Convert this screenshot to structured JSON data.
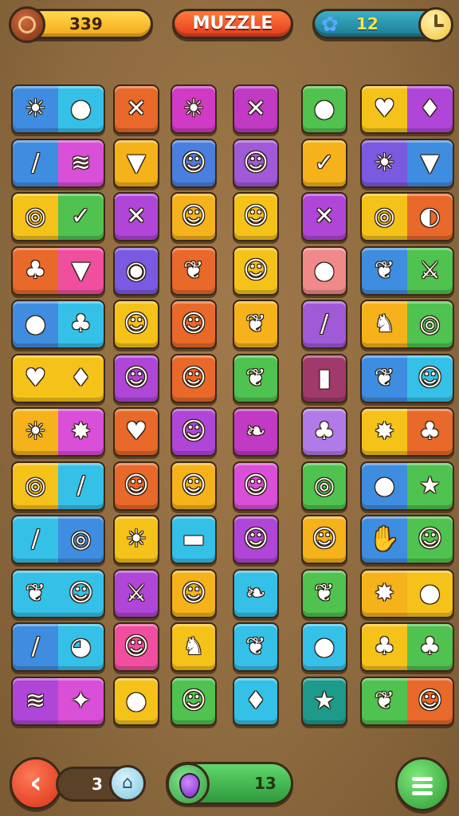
{
  "header": {
    "coins": "339",
    "title": "MUZZLE",
    "gems": "12",
    "icons": [
      "coin-icon",
      "gem-icon",
      "clock-icon"
    ]
  },
  "footer": {
    "back_label": "‹",
    "moves": "3",
    "energy": "13",
    "icons": [
      "back-arrow-icon",
      "lock-icon",
      "energy-drop-icon",
      "menu-icon"
    ]
  },
  "board": {
    "rows": [
      [
        {
          "cols": [
            0,
            1
          ],
          "bg": [
            "#3f8de0",
            "#35c0e8"
          ],
          "icons": [
            "☀",
            "●"
          ],
          "names": [
            "gear-icon",
            "lemon-icon"
          ]
        },
        {
          "cols": [
            2
          ],
          "bg": [
            "#e8692a"
          ],
          "icons": [
            "✕"
          ],
          "names": [
            "crossed-tools-icon"
          ]
        },
        {
          "cols": [
            3
          ],
          "bg": [
            "#d03ac4"
          ],
          "icons": [
            "☀"
          ],
          "names": [
            "sun-icon"
          ]
        },
        {
          "cols": [
            4
          ],
          "bg": [
            "#c03ac4"
          ],
          "icons": [
            "✕"
          ],
          "names": [
            "crossed-tools-icon"
          ]
        },
        {
          "cols": [
            5
          ],
          "bg": [
            "#4fc24f"
          ],
          "icons": [
            "●"
          ],
          "names": [
            "jar-icon"
          ]
        },
        {
          "cols": [
            6,
            7
          ],
          "bg": [
            "#f5c21a",
            "#b046d8"
          ],
          "icons": [
            "♥",
            "♦"
          ],
          "names": [
            "heart-icon",
            "eggplant-icon"
          ]
        }
      ],
      [
        {
          "cols": [
            0,
            1
          ],
          "bg": [
            "#3f8de0",
            "#d94fd8"
          ],
          "icons": [
            "/",
            "≋"
          ],
          "names": [
            "brush-icon",
            "bacon-icon"
          ]
        },
        {
          "cols": [
            2
          ],
          "bg": [
            "#f5b21a"
          ],
          "icons": [
            "▼"
          ],
          "names": [
            "ice-cream-icon"
          ]
        },
        {
          "cols": [
            3
          ],
          "bg": [
            "#4a7fe0"
          ],
          "icons": [
            "☺"
          ],
          "names": [
            "cat-face-icon"
          ]
        },
        {
          "cols": [
            4
          ],
          "bg": [
            "#a05ad8"
          ],
          "icons": [
            "☺"
          ],
          "names": [
            "boy-face-icon"
          ]
        },
        {
          "cols": [
            5
          ],
          "bg": [
            "#f5b21a"
          ],
          "icons": [
            "✓"
          ],
          "names": [
            "check-icon"
          ]
        },
        {
          "cols": [
            6,
            7
          ],
          "bg": [
            "#7a5ae0",
            "#3f8de0"
          ],
          "icons": [
            "☀",
            "▼"
          ],
          "names": [
            "sun-icon",
            "ice-cream-icon"
          ]
        }
      ],
      [
        {
          "cols": [
            0,
            1
          ],
          "bg": [
            "#f5c21a",
            "#4fc24f"
          ],
          "icons": [
            "◎",
            "✓"
          ],
          "names": [
            "swirl-icon",
            "leaf-icon"
          ]
        },
        {
          "cols": [
            2
          ],
          "bg": [
            "#b046d8"
          ],
          "icons": [
            "✕"
          ],
          "names": [
            "crossed-tools-icon"
          ]
        },
        {
          "cols": [
            3
          ],
          "bg": [
            "#f5b21a"
          ],
          "icons": [
            "☺"
          ],
          "names": [
            "mouse-face-icon"
          ]
        },
        {
          "cols": [
            4
          ],
          "bg": [
            "#f5c21a"
          ],
          "icons": [
            "☺"
          ],
          "names": [
            "bear-face-icon"
          ]
        },
        {
          "cols": [
            5
          ],
          "bg": [
            "#b046d8"
          ],
          "icons": [
            "✕"
          ],
          "names": [
            "crossed-tools-icon"
          ]
        },
        {
          "cols": [
            6,
            7
          ],
          "bg": [
            "#f5c21a",
            "#e8692a"
          ],
          "icons": [
            "◎",
            "◐"
          ],
          "names": [
            "swirl-icon",
            "pepper-icon"
          ]
        }
      ],
      [
        {
          "cols": [
            0,
            1
          ],
          "bg": [
            "#e8692a",
            "#f04fa0"
          ],
          "icons": [
            "♣",
            "▼"
          ],
          "names": [
            "pepper-icon",
            "ice-cream-icon"
          ]
        },
        {
          "cols": [
            2
          ],
          "bg": [
            "#7a5ae0"
          ],
          "icons": [
            "◉"
          ],
          "names": [
            "donut-icon"
          ]
        },
        {
          "cols": [
            3
          ],
          "bg": [
            "#e8692a"
          ],
          "icons": [
            "❦"
          ],
          "names": [
            "leaf-icon"
          ]
        },
        {
          "cols": [
            4
          ],
          "bg": [
            "#f5c21a"
          ],
          "icons": [
            "☺"
          ],
          "names": [
            "robot-face-icon"
          ]
        },
        {
          "cols": [
            5
          ],
          "bg": [
            "#f08a8a"
          ],
          "icons": [
            "●"
          ],
          "names": [
            "apple-icon"
          ]
        },
        {
          "cols": [
            6,
            7
          ],
          "bg": [
            "#3f8de0",
            "#4fc24f"
          ],
          "icons": [
            "❦",
            "⚔"
          ],
          "names": [
            "leaf-icon",
            "sword-icon"
          ]
        }
      ],
      [
        {
          "cols": [
            0,
            1
          ],
          "bg": [
            "#3f8de0",
            "#35c0e8"
          ],
          "icons": [
            "●",
            "♣"
          ],
          "names": [
            "apple-icon",
            "tree-icon"
          ]
        },
        {
          "cols": [
            2
          ],
          "bg": [
            "#f5c21a"
          ],
          "icons": [
            "☺"
          ],
          "names": [
            "blob-face-icon"
          ]
        },
        {
          "cols": [
            3
          ],
          "bg": [
            "#e8692a"
          ],
          "icons": [
            "☺"
          ],
          "names": [
            "boy-face-icon"
          ]
        },
        {
          "cols": [
            4
          ],
          "bg": [
            "#f5b21a"
          ],
          "icons": [
            "❦"
          ],
          "names": [
            "leaf-icon"
          ]
        },
        {
          "cols": [
            5
          ],
          "bg": [
            "#a05ad8"
          ],
          "icons": [
            "/"
          ],
          "names": [
            "carrot-icon"
          ]
        },
        {
          "cols": [
            6,
            7
          ],
          "bg": [
            "#f5b21a",
            "#4fc24f"
          ],
          "icons": [
            "♞",
            "◎"
          ],
          "names": [
            "wood-icon",
            "lime-icon"
          ]
        }
      ],
      [
        {
          "cols": [
            0,
            1
          ],
          "bg": [
            "#f5c21a",
            "#f5c21a"
          ],
          "icons": [
            "♥",
            "♦"
          ],
          "names": [
            "heart-icon",
            "peach-icon"
          ]
        },
        {
          "cols": [
            2
          ],
          "bg": [
            "#b046d8"
          ],
          "icons": [
            "☺"
          ],
          "names": [
            "monkey-face-icon"
          ]
        },
        {
          "cols": [
            3
          ],
          "bg": [
            "#e8692a"
          ],
          "icons": [
            "☺"
          ],
          "names": [
            "cat-face-icon"
          ]
        },
        {
          "cols": [
            4
          ],
          "bg": [
            "#4fc24f"
          ],
          "icons": [
            "❦"
          ],
          "names": [
            "leaf-icon"
          ]
        },
        {
          "cols": [
            5
          ],
          "bg": [
            "#a03a6a"
          ],
          "icons": [
            "▮"
          ],
          "names": [
            "bottle-icon"
          ]
        },
        {
          "cols": [
            6,
            7
          ],
          "bg": [
            "#3f8de0",
            "#35c0e8"
          ],
          "icons": [
            "❦",
            "☺"
          ],
          "names": [
            "leaf-icon",
            "smiley-icon"
          ]
        }
      ],
      [
        {
          "cols": [
            0,
            1
          ],
          "bg": [
            "#f5b21a",
            "#d94fd8"
          ],
          "icons": [
            "☀",
            "✸"
          ],
          "names": [
            "sun-icon",
            "star-burst-icon"
          ]
        },
        {
          "cols": [
            2
          ],
          "bg": [
            "#e8692a"
          ],
          "icons": [
            "♥"
          ],
          "names": [
            "heart-face-icon"
          ]
        },
        {
          "cols": [
            3
          ],
          "bg": [
            "#b046d8"
          ],
          "icons": [
            "☺"
          ],
          "names": [
            "lion-face-icon"
          ]
        },
        {
          "cols": [
            4
          ],
          "bg": [
            "#c03ac4"
          ],
          "icons": [
            "❧"
          ],
          "names": [
            "vine-icon"
          ]
        },
        {
          "cols": [
            5
          ],
          "bg": [
            "#b07ae8"
          ],
          "icons": [
            "♣"
          ],
          "names": [
            "tree-icon"
          ]
        },
        {
          "cols": [
            6,
            7
          ],
          "bg": [
            "#f5c21a",
            "#e8692a"
          ],
          "icons": [
            "✸",
            "♣"
          ],
          "names": [
            "splash-icon",
            "tree-icon"
          ]
        }
      ],
      [
        {
          "cols": [
            0,
            1
          ],
          "bg": [
            "#f5c21a",
            "#35c0e8"
          ],
          "icons": [
            "◎",
            "/"
          ],
          "names": [
            "swirl-icon",
            "carrot-icon"
          ]
        },
        {
          "cols": [
            2
          ],
          "bg": [
            "#e8692a"
          ],
          "icons": [
            "☺"
          ],
          "names": [
            "robot-face-icon"
          ]
        },
        {
          "cols": [
            3
          ],
          "bg": [
            "#f5b21a"
          ],
          "icons": [
            "☺"
          ],
          "names": [
            "cat-face-icon"
          ]
        },
        {
          "cols": [
            4
          ],
          "bg": [
            "#d94fd8"
          ],
          "icons": [
            "☺"
          ],
          "names": [
            "sheep-face-icon"
          ]
        },
        {
          "cols": [
            5
          ],
          "bg": [
            "#4fc24f"
          ],
          "icons": [
            "◎"
          ],
          "names": [
            "swirl-icon"
          ]
        },
        {
          "cols": [
            6,
            7
          ],
          "bg": [
            "#3f8de0",
            "#4fc24f"
          ],
          "icons": [
            "●",
            "★"
          ],
          "names": [
            "apple-icon",
            "star-icon"
          ]
        }
      ],
      [
        {
          "cols": [
            0,
            1
          ],
          "bg": [
            "#35c0e8",
            "#3f8de0"
          ],
          "icons": [
            "/",
            "◎"
          ],
          "names": [
            "carrot-icon",
            "ball-icon"
          ]
        },
        {
          "cols": [
            2
          ],
          "bg": [
            "#f5c21a"
          ],
          "icons": [
            "☀"
          ],
          "names": [
            "sun-icon"
          ]
        },
        {
          "cols": [
            3
          ],
          "bg": [
            "#35c0e8"
          ],
          "icons": [
            "▬"
          ],
          "names": [
            "pill-bar-icon"
          ]
        },
        {
          "cols": [
            4
          ],
          "bg": [
            "#b046d8"
          ],
          "icons": [
            "☺"
          ],
          "names": [
            "monkey-face-icon"
          ]
        },
        {
          "cols": [
            5
          ],
          "bg": [
            "#f5b21a"
          ],
          "icons": [
            "☺"
          ],
          "names": [
            "face-icon"
          ]
        },
        {
          "cols": [
            6,
            7
          ],
          "bg": [
            "#3f8de0",
            "#4fc24f"
          ],
          "icons": [
            "✋",
            "☺"
          ],
          "names": [
            "hand-icon",
            "smiley-icon"
          ]
        }
      ],
      [
        {
          "cols": [
            0,
            1
          ],
          "bg": [
            "#35c0e8",
            "#35c0e8"
          ],
          "icons": [
            "❦",
            "☺"
          ],
          "names": [
            "leaf-icon",
            "ghost-icon"
          ]
        },
        {
          "cols": [
            2
          ],
          "bg": [
            "#b046d8"
          ],
          "icons": [
            "⚔"
          ],
          "names": [
            "sword-icon"
          ]
        },
        {
          "cols": [
            3
          ],
          "bg": [
            "#f5b21a"
          ],
          "icons": [
            "☺"
          ],
          "names": [
            "girl-face-icon"
          ]
        },
        {
          "cols": [
            4
          ],
          "bg": [
            "#35c0e8"
          ],
          "icons": [
            "❧"
          ],
          "names": [
            "branch-icon"
          ]
        },
        {
          "cols": [
            5
          ],
          "bg": [
            "#4fc24f"
          ],
          "icons": [
            "❦"
          ],
          "names": [
            "leaf-icon"
          ]
        },
        {
          "cols": [
            6,
            7
          ],
          "bg": [
            "#f5b21a",
            "#f5c21a"
          ],
          "icons": [
            "✸",
            "●"
          ],
          "names": [
            "splat-icon",
            "apple-icon"
          ]
        }
      ],
      [
        {
          "cols": [
            0,
            1
          ],
          "bg": [
            "#3f8de0",
            "#35c0e8"
          ],
          "icons": [
            "/",
            "◕"
          ],
          "names": [
            "brush-icon",
            "blob-icon"
          ]
        },
        {
          "cols": [
            2
          ],
          "bg": [
            "#f04fa0"
          ],
          "icons": [
            "☺"
          ],
          "names": [
            "chick-face-icon"
          ]
        },
        {
          "cols": [
            3
          ],
          "bg": [
            "#f5c21a"
          ],
          "icons": [
            "♞"
          ],
          "names": [
            "dog-icon"
          ]
        },
        {
          "cols": [
            4
          ],
          "bg": [
            "#35c0e8"
          ],
          "icons": [
            "❦"
          ],
          "names": [
            "leaf-icon"
          ]
        },
        {
          "cols": [
            5
          ],
          "bg": [
            "#35c0e8"
          ],
          "icons": [
            "●"
          ],
          "names": [
            "apple-icon"
          ]
        },
        {
          "cols": [
            6,
            7
          ],
          "bg": [
            "#f5c21a",
            "#4fc24f"
          ],
          "icons": [
            "♣",
            "♣"
          ],
          "names": [
            "bush-icon",
            "tree-icon"
          ]
        }
      ],
      [
        {
          "cols": [
            0,
            1
          ],
          "bg": [
            "#b046d8",
            "#d94fd8"
          ],
          "icons": [
            "≋",
            "✦"
          ],
          "names": [
            "cookie-icon",
            "sparkle-icon"
          ]
        },
        {
          "cols": [
            2
          ],
          "bg": [
            "#f5c21a"
          ],
          "icons": [
            "●"
          ],
          "names": [
            "ball-icon"
          ]
        },
        {
          "cols": [
            3
          ],
          "bg": [
            "#4fc24f"
          ],
          "icons": [
            "☺"
          ],
          "names": [
            "cat-face-icon"
          ]
        },
        {
          "cols": [
            4
          ],
          "bg": [
            "#35c0e8"
          ],
          "icons": [
            "♦"
          ],
          "names": [
            "peach-icon"
          ]
        },
        {
          "cols": [
            5
          ],
          "bg": [
            "#1d9a8a"
          ],
          "icons": [
            "★"
          ],
          "names": [
            "star-icon"
          ]
        },
        {
          "cols": [
            6,
            7
          ],
          "bg": [
            "#4fc24f",
            "#e8692a"
          ],
          "icons": [
            "❦",
            "☺"
          ],
          "names": [
            "leaf-icon",
            "smiley-icon"
          ]
        }
      ]
    ]
  }
}
